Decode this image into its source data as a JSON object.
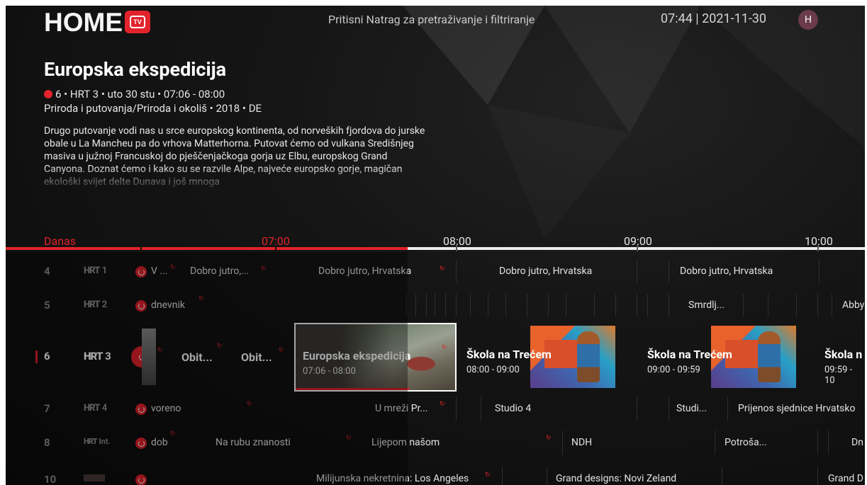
{
  "header": {
    "logo_text": "HOME",
    "logo_badge": "TV",
    "hint": "Pritisni Natrag za pretraživanje i filtriranje",
    "clock": "07:44 | 2021-11-30",
    "avatar_initial": "H"
  },
  "program": {
    "title": "Europska ekspedicija",
    "meta": "6 • HRT 3 • uto 30 stu • 07:06 - 08:00",
    "genre": "Priroda i putovanja/Priroda i okoliš • 2018 • DE",
    "description": "Drugo putovanje vodi nas u srce europskog kontinenta, od norveških fjordova do jurske obale u La Mancheu pa do vrhova Matterhorna. Putovat ćemo od vulkana Središnjeg masiva u južnoj Francuskoj do pješčenjačkoga gorja uz Elbu, europskog Grand Canyona. Doznat ćemo i kako su se razvile Alpe, najveće europsko gorje, magičan ekološki svijet delte Dunava i još mnoga"
  },
  "timeline": {
    "today": "Danas",
    "t0": "07:00",
    "t1": "08:00",
    "t2": "09:00",
    "t3": "10:00"
  },
  "channels": [
    {
      "num": "4",
      "logo": "HRT",
      "logo_sub": "1",
      "programs": [
        "V ...",
        "Dobro jutro,...",
        "Dobro jutro, Hrvatska",
        "Dobro jutro, Hrvatska",
        "Dobro jutro, Hrvatska"
      ]
    },
    {
      "num": "5",
      "logo": "HRT",
      "logo_sub": "2",
      "programs": [
        "dnevnik",
        "Smrdlj...",
        "Abby"
      ]
    },
    {
      "num": "6",
      "logo": "HRT",
      "logo_sub": "3",
      "programs": [
        "Obit...",
        "Obit..."
      ],
      "focused": {
        "title": "Europska ekspedicija",
        "time": "07:06 - 08:00"
      },
      "cards": [
        {
          "title": "Škola na Trećem",
          "time": "08:00 - 09:00"
        },
        {
          "title": "Škola na Trećem",
          "time": "09:00 - 09:59"
        },
        {
          "title": "Škola n",
          "time": "09:59 - 10"
        }
      ]
    },
    {
      "num": "7",
      "logo": "HRT",
      "logo_sub": "4",
      "programs": [
        "voreno",
        "U mreži Pr...",
        "Studio 4",
        "Studi...",
        "Prijenos sjednice Hrvatsko"
      ]
    },
    {
      "num": "8",
      "logo": "HRT",
      "logo_sub": "Int.",
      "programs": [
        "dob",
        "Na rubu znanosti",
        "Lijepom našom",
        "NDH",
        "Potroša...",
        "Dn"
      ]
    },
    {
      "num": "10",
      "logo": "",
      "logo_sub": "",
      "programs": [
        "Milijunska nekretnina: Los Angeles",
        "Grand designs: Novi Zeland",
        "Grand D"
      ]
    }
  ],
  "colors": {
    "accent": "#e3232b",
    "background": "#101010",
    "text": "#e6e6e6"
  }
}
